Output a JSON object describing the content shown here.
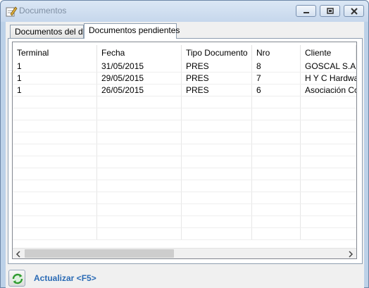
{
  "window": {
    "title": "Documentos"
  },
  "tabs": [
    {
      "label": "Documentos del día"
    },
    {
      "label": "Documentos pendientes"
    }
  ],
  "table": {
    "columns": [
      "Terminal",
      "Fecha",
      "Tipo Documento",
      "Nro",
      "Cliente"
    ],
    "rows": [
      [
        "1",
        "31/05/2015",
        "PRES",
        "8",
        "GOSCAL S.A."
      ],
      [
        "1",
        "29/05/2015",
        "PRES",
        "7",
        "H Y C Hardwar"
      ],
      [
        "1",
        "26/05/2015",
        "PRES",
        "6",
        "Asociación Coo"
      ]
    ]
  },
  "footer": {
    "refresh_label": "Actualizar <F5>"
  },
  "colors": {
    "accent": "#2b6bb5",
    "refresh_icon": "#3aa53a"
  }
}
